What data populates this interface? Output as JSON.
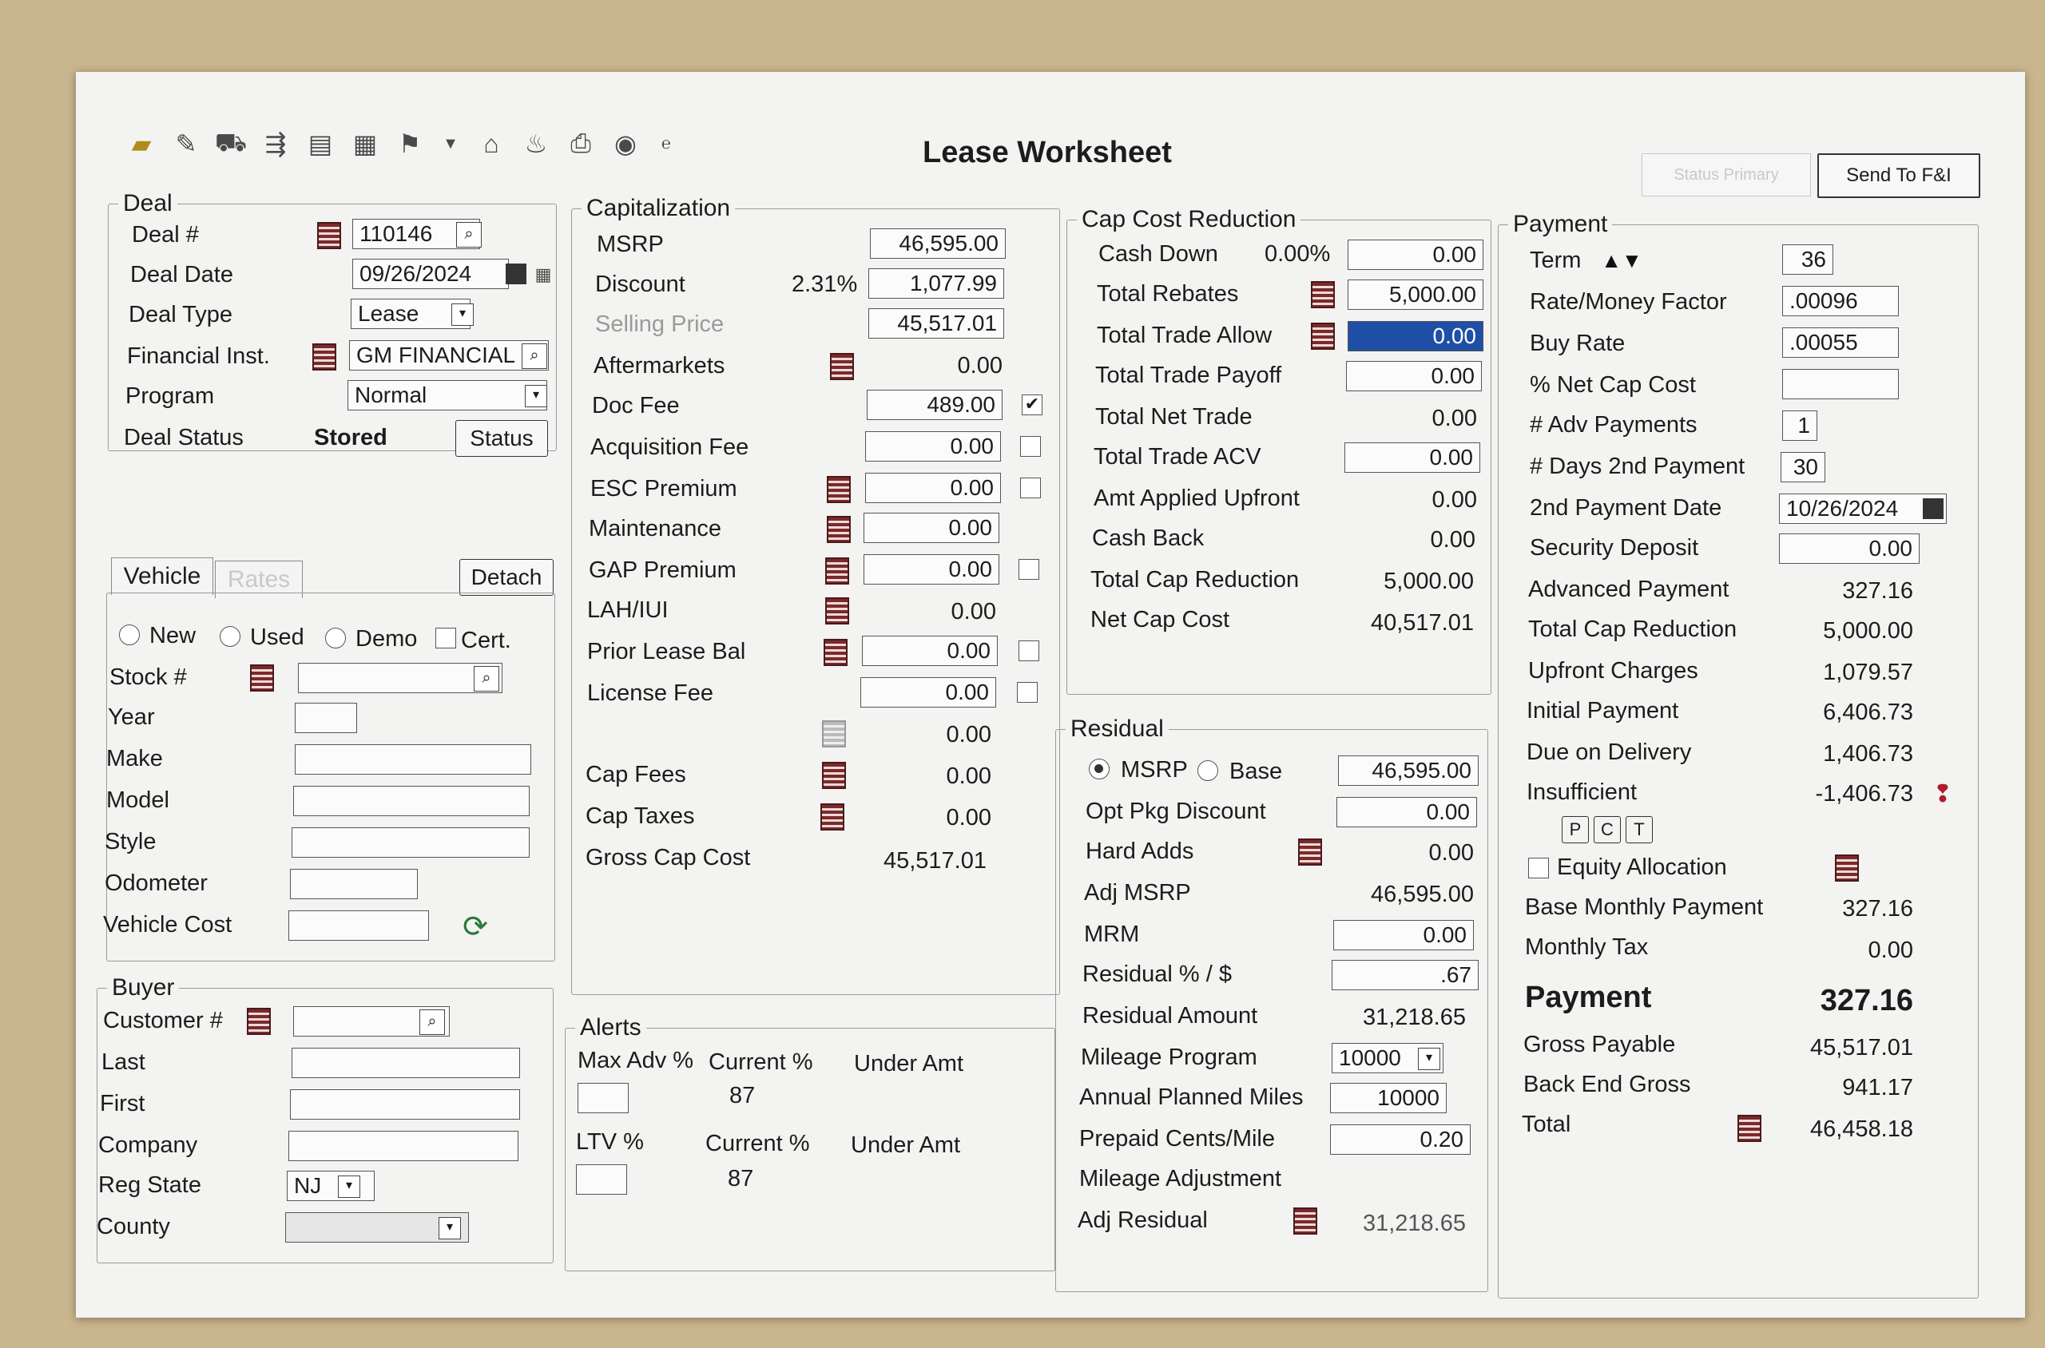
{
  "window": {
    "title": "Lease Worksheet",
    "disabled_button": "Status Primary",
    "send_button": "Send To F&I"
  },
  "deal": {
    "legend": "Deal",
    "deal_no_label": "Deal #",
    "deal_no": "110146",
    "deal_date_label": "Deal Date",
    "deal_date": "09/26/2024",
    "deal_type_label": "Deal Type",
    "deal_type": "Lease",
    "fin_inst_label": "Financial Inst.",
    "fin_inst": "GM FINANCIAL",
    "program_label": "Program",
    "program": "Normal",
    "status_label": "Deal Status",
    "status": "Stored",
    "status_button": "Status"
  },
  "vehicle": {
    "tab_vehicle": "Vehicle",
    "tab_rates": "Rates",
    "detach": "Detach",
    "new": "New",
    "used": "Used",
    "demo": "Demo",
    "cert": "Cert.",
    "stock": "Stock #",
    "year": "Year",
    "make": "Make",
    "model": "Model",
    "style": "Style",
    "odometer": "Odometer",
    "vehicle_cost": "Vehicle Cost"
  },
  "buyer": {
    "legend": "Buyer",
    "customer": "Customer #",
    "last": "Last",
    "first": "First",
    "company": "Company",
    "reg_state": "Reg State",
    "reg_state_value": "NJ",
    "county": "County"
  },
  "capitalization": {
    "legend": "Capitalization",
    "msrp_label": "MSRP",
    "msrp": "46,595.00",
    "discount_label": "Discount",
    "discount_pct": "2.31%",
    "discount": "1,077.99",
    "selling_label": "Selling Price",
    "selling": "45,517.01",
    "aftermarkets_label": "Aftermarkets",
    "aftermarkets": "0.00",
    "doc_fee_label": "Doc Fee",
    "doc_fee": "489.00",
    "acq_fee_label": "Acquisition Fee",
    "acq_fee": "0.00",
    "esc_label": "ESC Premium",
    "esc": "0.00",
    "maint_label": "Maintenance",
    "maint": "0.00",
    "gap_label": "GAP Premium",
    "gap": "0.00",
    "lah_label": "LAH/IUI",
    "lah": "0.00",
    "prior_label": "Prior Lease Bal",
    "prior": "0.00",
    "license_label": "License Fee",
    "license": "0.00",
    "blank_value": "0.00",
    "cap_fees_label": "Cap Fees",
    "cap_fees": "0.00",
    "cap_taxes_label": "Cap Taxes",
    "cap_taxes": "0.00",
    "gross_label": "Gross Cap Cost",
    "gross": "45,517.01"
  },
  "alerts": {
    "legend": "Alerts",
    "max_adv": "Max Adv %",
    "current": "Current %",
    "under_amt": "Under Amt",
    "current_val_1": "87",
    "ltv": "LTV %",
    "current_val_2": "87"
  },
  "cap_cost_reduction": {
    "legend": "Cap Cost Reduction",
    "cash_down_label": "Cash Down",
    "cash_down_pct": "0.00%",
    "cash_down": "0.00",
    "rebates_label": "Total Rebates",
    "rebates": "5,000.00",
    "trade_allow_label": "Total Trade Allow",
    "trade_allow": "0.00",
    "trade_payoff_label": "Total Trade Payoff",
    "trade_payoff": "0.00",
    "net_trade_label": "Total Net Trade",
    "net_trade": "0.00",
    "trade_acv_label": "Total Trade ACV",
    "trade_acv": "0.00",
    "applied_label": "Amt Applied Upfront",
    "applied": "0.00",
    "cash_back_label": "Cash Back",
    "cash_back": "0.00",
    "total_label": "Total Cap Reduction",
    "total": "5,000.00",
    "net_cap_label": "Net Cap Cost",
    "net_cap": "40,517.01"
  },
  "residual": {
    "legend": "Residual",
    "msrp": "MSRP",
    "base": "Base",
    "msrp_value": "46,595.00",
    "opt_pkg_label": "Opt Pkg Discount",
    "opt_pkg": "0.00",
    "hard_adds_label": "Hard Adds",
    "hard_adds": "0.00",
    "adj_msrp_label": "Adj MSRP",
    "adj_msrp": "46,595.00",
    "mrm_label": "MRM",
    "mrm": "0.00",
    "pct_label": "Residual % / $",
    "pct": ".67",
    "amount_label": "Residual Amount",
    "amount": "31,218.65",
    "mileage_label": "Mileage Program",
    "mileage": "10000",
    "annual_label": "Annual Planned Miles",
    "annual": "10000",
    "prepaid_label": "Prepaid Cents/Mile",
    "prepaid": "0.20",
    "mileage_adj_label": "Mileage Adjustment",
    "adj_residual_label": "Adj Residual",
    "adj_residual": "31,218.65"
  },
  "payment": {
    "legend": "Payment",
    "term_label": "Term",
    "term": "36",
    "rate_label": "Rate/Money Factor",
    "rate": ".00096",
    "buy_rate_label": "Buy Rate",
    "buy_rate": ".00055",
    "net_cap_pct_label": "% Net Cap Cost",
    "adv_label": "# Adv Payments",
    "adv": "1",
    "days_label": "# Days 2nd Payment",
    "days": "30",
    "date2_label": "2nd Payment Date",
    "date2": "10/26/2024",
    "security_label": "Security Deposit",
    "security": "0.00",
    "advanced_label": "Advanced Payment",
    "advanced": "327.16",
    "total_cap_label": "Total Cap Reduction",
    "total_cap": "5,000.00",
    "upfront_label": "Upfront Charges",
    "upfront": "1,079.57",
    "initial_label": "Initial Payment",
    "initial": "6,406.73",
    "due_label": "Due on Delivery",
    "due": "1,406.73",
    "insufficient_label": "Insufficient",
    "insufficient": "-1,406.73",
    "p": "P",
    "c": "C",
    "t": "T",
    "equity_label": "Equity Allocation",
    "base_label": "Base Monthly Payment",
    "base": "327.16",
    "tax_label": "Monthly Tax",
    "tax": "0.00",
    "payment_label": "Payment",
    "payment": "327.16",
    "gross_label": "Gross Payable",
    "gross": "45,517.01",
    "back_label": "Back End Gross",
    "back": "941.17",
    "total_label": "Total",
    "total": "46,458.18"
  }
}
